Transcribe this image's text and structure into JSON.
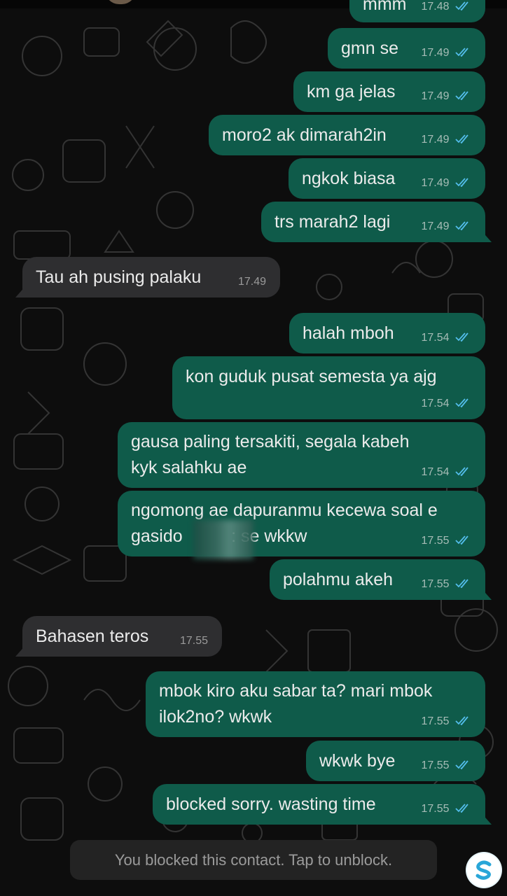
{
  "colors": {
    "outgoing_bubble": "#0f5b4a",
    "incoming_bubble": "#2e2e30",
    "read_ticks": "#53bdeb",
    "background": "#0d0d0d"
  },
  "partial_top": {
    "text": "mmm",
    "time": "17.48"
  },
  "messages": [
    {
      "dir": "out",
      "text": "gmn se",
      "time": "17.49",
      "status": "read"
    },
    {
      "dir": "out",
      "text": "km ga jelas",
      "time": "17.49",
      "status": "read"
    },
    {
      "dir": "out",
      "text": "moro2 ak dimarah2in",
      "time": "17.49",
      "status": "read"
    },
    {
      "dir": "out",
      "text": "ngkok biasa",
      "time": "17.49",
      "status": "read"
    },
    {
      "dir": "out",
      "text": "trs marah2 lagi",
      "time": "17.49",
      "status": "read"
    },
    {
      "dir": "in",
      "text": "Tau ah pusing palaku",
      "time": "17.49"
    },
    {
      "dir": "out",
      "text": "halah mboh",
      "time": "17.54",
      "status": "read"
    },
    {
      "dir": "out",
      "text": "kon guduk pusat semesta ya ajg",
      "time": "17.54",
      "status": "read"
    },
    {
      "dir": "out",
      "text": "gausa paling tersakiti, segala kabeh\nkyk salahku ae",
      "time": "17.54",
      "status": "read"
    },
    {
      "dir": "out",
      "text": "ngomong ae dapuranmu kecewa soal e\ngasido          : se wkkw",
      "time": "17.55",
      "status": "read"
    },
    {
      "dir": "out",
      "text": "polahmu akeh",
      "time": "17.55",
      "status": "read"
    },
    {
      "dir": "in",
      "text": "Bahasen teros",
      "time": "17.55"
    },
    {
      "dir": "out",
      "text": "mbok kiro aku sabar ta? mari mbok\nilok2no? wkwk",
      "time": "17.55",
      "status": "read"
    },
    {
      "dir": "out",
      "text": "wkwk bye",
      "time": "17.55",
      "status": "read"
    },
    {
      "dir": "out",
      "text": "blocked sorry. wasting time",
      "time": "17.55",
      "status": "read"
    }
  ],
  "blocked_banner": "You blocked this contact. Tap to unblock.",
  "watermark_logo": {
    "icon": "s-logo-icon",
    "letter": "S"
  }
}
